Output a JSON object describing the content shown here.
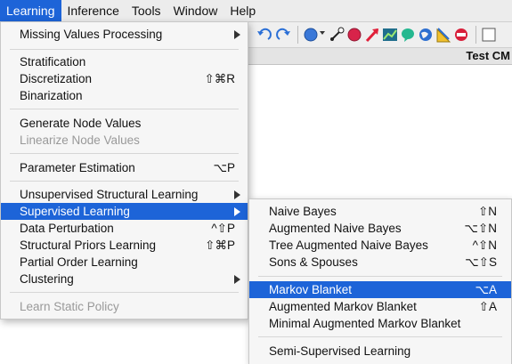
{
  "menubar": {
    "items": [
      {
        "label": "Learning",
        "active": true
      },
      {
        "label": "Inference",
        "active": false
      },
      {
        "label": "Tools",
        "active": false
      },
      {
        "label": "Window",
        "active": false
      },
      {
        "label": "Help",
        "active": false
      }
    ]
  },
  "toolbar": {
    "icons": [
      "undo-icon",
      "redo-icon",
      "node-icon",
      "chevron-down-icon",
      "arc-tool-icon",
      "evidence-node-icon",
      "arrow-tool-icon",
      "chart-icon",
      "comment-icon",
      "globe-icon",
      "ruler-icon",
      "stop-icon"
    ],
    "tab_label": "Test CM"
  },
  "learning_menu": {
    "missing_values": "Missing Values Processing",
    "stratification": "Stratification",
    "discretization": "Discretization",
    "discretization_sc": "⇧⌘R",
    "binarization": "Binarization",
    "generate_node_values": "Generate Node Values",
    "linearize_node_values": "Linearize Node Values",
    "parameter_estimation": "Parameter Estimation",
    "parameter_estimation_sc": "⌥P",
    "unsupervised": "Unsupervised Structural Learning",
    "supervised": "Supervised Learning",
    "data_perturbation": "Data Perturbation",
    "data_perturbation_sc": "^⇧P",
    "structural_priors": "Structural Priors Learning",
    "structural_priors_sc": "⇧⌘P",
    "partial_order": "Partial Order Learning",
    "clustering": "Clustering",
    "learn_static_policy": "Learn Static Policy"
  },
  "supervised_menu": {
    "naive_bayes": "Naive Bayes",
    "naive_bayes_sc": "⇧N",
    "augmented_naive_bayes": "Augmented Naive Bayes",
    "augmented_naive_bayes_sc": "⌥⇧N",
    "tree_augmented": "Tree Augmented Naive Bayes",
    "tree_augmented_sc": "^⇧N",
    "sons_spouses": "Sons & Spouses",
    "sons_spouses_sc": "⌥⇧S",
    "markov_blanket": "Markov Blanket",
    "markov_blanket_sc": "⌥A",
    "augmented_markov_blanket": "Augmented Markov Blanket",
    "augmented_markov_blanket_sc": "⇧A",
    "minimal_augmented": "Minimal Augmented Markov Blanket",
    "semi_supervised": "Semi-Supervised Learning"
  },
  "colors": {
    "highlight": "#1d64d8"
  }
}
